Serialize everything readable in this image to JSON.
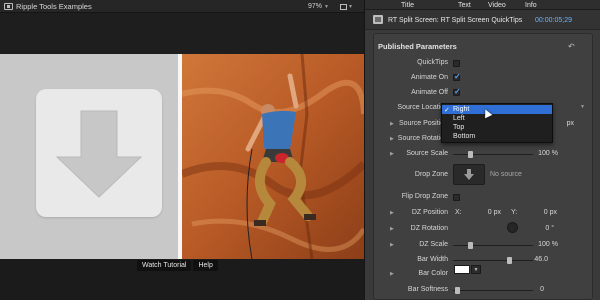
{
  "viewer": {
    "title": "Ripple Tools Examples",
    "zoom": "97%",
    "view_caret": "▾",
    "footer_buttons": [
      "Watch Tutorial",
      "Help"
    ]
  },
  "inspector": {
    "tabs": [
      "Title",
      "Text",
      "Video",
      "Info"
    ],
    "header_title": "RT Split Screen: RT Split Screen QuickTips",
    "timecode": "00:00:05;29",
    "section_title": "Published Parameters",
    "rows": {
      "quicktips": "QuickTips",
      "animate_on": "Animate On",
      "animate_off": "Animate Off",
      "source_location": "Source Location",
      "source_position": "Source Position",
      "source_position_unit": "px",
      "source_rotation": "Source Rotation",
      "source_scale": "Source Scale",
      "source_scale_value": "100 %",
      "drop_zone": "Drop Zone",
      "drop_zone_text": "No source",
      "flip_drop_zone": "Flip Drop Zone",
      "dz_position": "DZ Position",
      "dz_x_label": "X:",
      "dz_x_value": "0 px",
      "dz_y_label": "Y:",
      "dz_y_value": "0 px",
      "dz_rotation": "DZ Rotation",
      "dz_rotation_value": "0 °",
      "dz_scale": "DZ Scale",
      "dz_scale_value": "100 %",
      "bar_width": "Bar Width",
      "bar_width_value": "46.0",
      "bar_color": "Bar Color",
      "bar_softness": "Bar Softness",
      "bar_softness_value": "0"
    },
    "source_location_options": [
      "Right",
      "Left",
      "Top",
      "Bottom"
    ],
    "source_location_selected": "Right"
  },
  "colors": {
    "accent_blue": "#2f6fd6",
    "timecode_blue": "#6ab4ff",
    "check_blue": "#4ea1ff"
  }
}
